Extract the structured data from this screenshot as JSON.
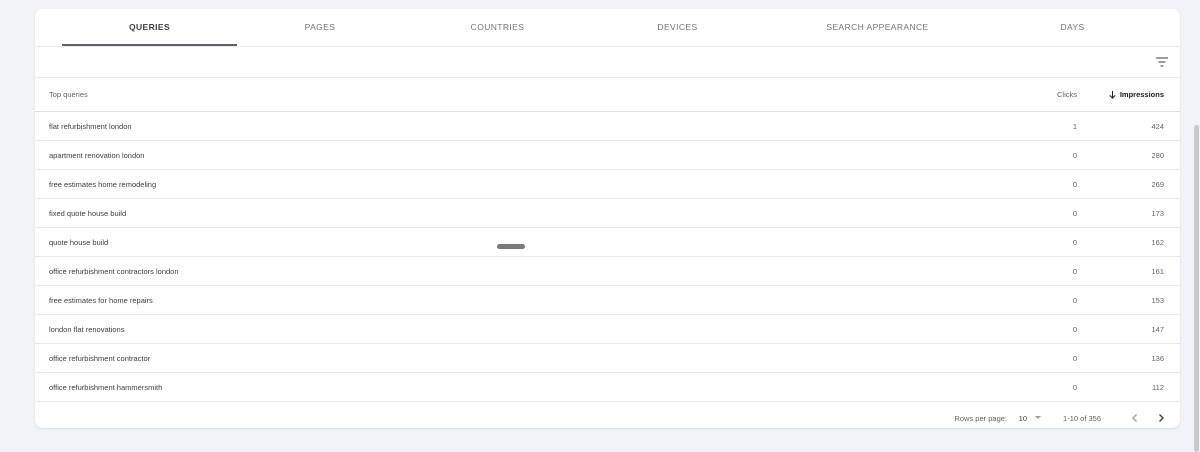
{
  "tabs": [
    {
      "label": "QUERIES",
      "active": true
    },
    {
      "label": "PAGES",
      "active": false
    },
    {
      "label": "COUNTRIES",
      "active": false
    },
    {
      "label": "DEVICES",
      "active": false
    },
    {
      "label": "SEARCH APPEARANCE",
      "active": false
    },
    {
      "label": "DAYS",
      "active": false
    }
  ],
  "toolbar": {
    "filter_icon": "filter-icon"
  },
  "table": {
    "headers": {
      "query": "Top queries",
      "clicks": "Clicks",
      "impressions": "Impressions"
    },
    "sort_icon": "arrow-down-icon",
    "rows": [
      {
        "query": "flat refurbishment london",
        "clicks": "1",
        "impressions": "424"
      },
      {
        "query": "apartment renovation london",
        "clicks": "0",
        "impressions": "280"
      },
      {
        "query": "free estimates home remodeling",
        "clicks": "0",
        "impressions": "269"
      },
      {
        "query": "fixed quote house build",
        "clicks": "0",
        "impressions": "173"
      },
      {
        "query": "quote house build",
        "clicks": "0",
        "impressions": "162"
      },
      {
        "query": "office refurbishment contractors london",
        "clicks": "0",
        "impressions": "161"
      },
      {
        "query": "free estimates for home repairs",
        "clicks": "0",
        "impressions": "153"
      },
      {
        "query": "london flat renovations",
        "clicks": "0",
        "impressions": "147"
      },
      {
        "query": "office refurbishment contractor",
        "clicks": "0",
        "impressions": "136"
      },
      {
        "query": "office refurbishment hammersmith",
        "clicks": "0",
        "impressions": "112"
      }
    ]
  },
  "pagination": {
    "rows_per_page_label": "Rows per page:",
    "rows_per_page_value": "10",
    "range": "1-10 of 356"
  },
  "colors": {
    "background": "#f1f3f6",
    "card": "#ffffff",
    "active_tab_indicator": "#5f6368"
  }
}
